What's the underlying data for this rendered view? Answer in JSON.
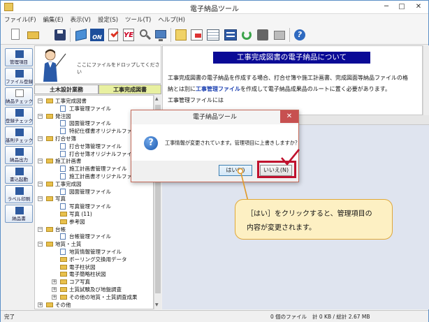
{
  "window": {
    "title": "電子納品ツール",
    "minimize": "─",
    "maximize": "□",
    "close": "✕"
  },
  "menu": [
    "ファイル(F)",
    "編集(E)",
    "表示(V)",
    "設定(S)",
    "ツール(T)",
    "ヘルプ(H)"
  ],
  "toolbar_icons": [
    "new-file-icon",
    "open-folder-icon",
    "save-icon",
    "box-icon",
    "on-icon",
    "check-icon",
    "ye-icon",
    "magnifier-icon",
    "monitor-icon",
    "tree-view-icon",
    "convert-icon",
    "grid-icon",
    "report-icon",
    "refresh-icon",
    "stamp-icon",
    "disk-icon",
    "help-icon"
  ],
  "sidebar": {
    "items": [
      {
        "label": "管理項目",
        "icon": "edit-icon"
      },
      {
        "label": "ファイル登録",
        "icon": "file-register-icon"
      },
      {
        "label": "納品チェック",
        "icon": "check-icon"
      },
      {
        "label": "登録チェック",
        "icon": "register-check-icon"
      },
      {
        "label": "基則チェック",
        "icon": "rule-check-icon"
      },
      {
        "label": "納品出力",
        "icon": "output-icon"
      },
      {
        "label": "書込起動",
        "icon": "write-icon"
      },
      {
        "label": "ラベル印刷",
        "icon": "label-print-icon"
      },
      {
        "label": "納品書",
        "icon": "delivery-note-icon"
      }
    ]
  },
  "drop_text": "ここにファイルをドロップしてください",
  "tabs": [
    "土木設計業務",
    "工事完成図書"
  ],
  "tree": [
    {
      "label": "工事完成図書",
      "level": 0,
      "type": "folder",
      "toggle": "−"
    },
    {
      "label": "工事管理ファイル",
      "level": 1,
      "type": "doc"
    },
    {
      "label": "発注図",
      "level": 0,
      "type": "folder",
      "toggle": "−"
    },
    {
      "label": "図面管理ファイル",
      "level": 1,
      "type": "doc"
    },
    {
      "label": "特記仕様書オリジナルファイル",
      "level": 1,
      "type": "doc"
    },
    {
      "label": "打合せ簿",
      "level": 0,
      "type": "folder",
      "toggle": "−"
    },
    {
      "label": "打合せ簿管理ファイル",
      "level": 1,
      "type": "doc"
    },
    {
      "label": "打合せ簿オリジナルファイル",
      "level": 1,
      "type": "doc"
    },
    {
      "label": "施工計画書",
      "level": 0,
      "type": "folder",
      "toggle": "−"
    },
    {
      "label": "施工計画書管理ファイル",
      "level": 1,
      "type": "doc"
    },
    {
      "label": "施工計画書オリジナルファイル",
      "level": 1,
      "type": "doc"
    },
    {
      "label": "工事完成図",
      "level": 0,
      "type": "folder",
      "toggle": "−"
    },
    {
      "label": "図面管理ファイル",
      "level": 1,
      "type": "doc"
    },
    {
      "label": "写真",
      "level": 0,
      "type": "folder",
      "toggle": "−"
    },
    {
      "label": "写真管理ファイル",
      "level": 1,
      "type": "doc"
    },
    {
      "label": "写真 (11)",
      "level": 1,
      "type": "folder"
    },
    {
      "label": "参考図",
      "level": 1,
      "type": "folder"
    },
    {
      "label": "台帳",
      "level": 0,
      "type": "folder",
      "toggle": "−"
    },
    {
      "label": "台帳管理ファイル",
      "level": 1,
      "type": "doc"
    },
    {
      "label": "地質・土質",
      "level": 0,
      "type": "folder",
      "toggle": "−"
    },
    {
      "label": "地質情報管理ファイル",
      "level": 1,
      "type": "doc"
    },
    {
      "label": "ボーリング交換用データ",
      "level": 1,
      "type": "folder"
    },
    {
      "label": "電子柱状図",
      "level": 1,
      "type": "folder"
    },
    {
      "label": "電子簡略柱状図",
      "level": 1,
      "type": "folder"
    },
    {
      "label": "コア写真",
      "level": 1,
      "type": "folder",
      "toggle": "+"
    },
    {
      "label": "土質試験及び地盤調査",
      "level": 1,
      "type": "folder",
      "toggle": "+"
    },
    {
      "label": "その他の地質・土質調査成果",
      "level": 1,
      "type": "folder",
      "toggle": "+"
    },
    {
      "label": "その他",
      "level": 0,
      "type": "folder",
      "toggle": "+"
    }
  ],
  "content": {
    "heading": "工事完成図書の電子納品について",
    "line1": "工事完成図書の電子納品を作成する場合、打合せ簿や施工計画書、完成図面等納品ファイルの格",
    "line2_pre": "納とは別に",
    "line2_link": "工事管理ファイル",
    "line2_post": "を作成して電子納品成果品のルートに置く必要があります。",
    "line3": "工事管理ファイルには"
  },
  "dialog": {
    "title": "電子納品ツール",
    "close": "✕",
    "message": "工事情報が変更されています。管理項目に上書きしますか？",
    "yes": "はい(Y)",
    "no": "いいえ(N)"
  },
  "callout": {
    "line1": "［はい］をクリックすると、管理項目の",
    "line2": "内容が変更されます。"
  },
  "status": {
    "left": "完了",
    "files": "0 個のファイル",
    "size": "計 0 KB / 総計 2.67 MB"
  },
  "colors": {
    "heading_bg": "#0a0a96",
    "highlight_border": "#c0112d",
    "callout_bg": "#fdf0c3",
    "dialog_close_bg": "#c75050"
  }
}
